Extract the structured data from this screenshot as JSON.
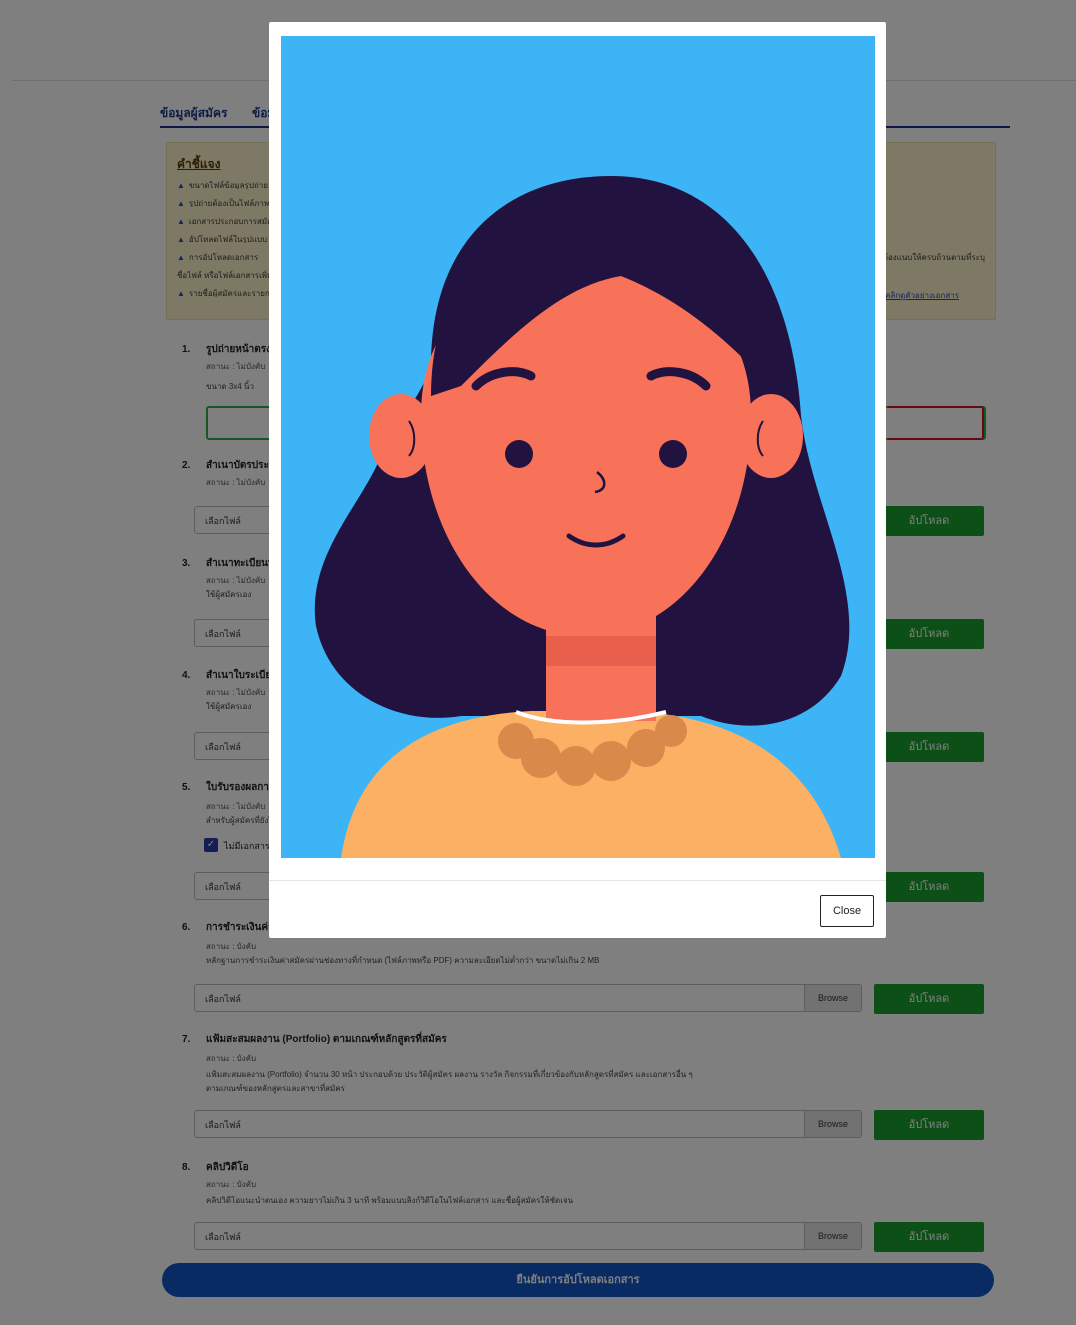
{
  "tabs": [
    {
      "label": "ข้อมูลผู้สมัคร"
    },
    {
      "label": "ข้อมูล"
    }
  ],
  "notice": {
    "title": "คำชี้แจง",
    "lines": [
      "ขนาดไฟล์ข้อมูลรูปถ่าย",
      "รูปถ่ายต้องเป็นไฟล์ภาพ",
      "เอกสารประกอบการสมัคร",
      "อัปโหลดไฟล์ในรูปแบบ",
      "การอัปโหลดเอกสาร",
      "ชื่อไฟล์ หรือไฟล์เอกสารเพิ่มเติม",
      "รายชื่อผู้สมัครและรายการ"
    ],
    "right_line": "และเอกสารที่จำเป็นต้องแนบให้ครบถ้วนตามที่ระบุ",
    "link": "คลิกดูตัวอย่างเอกสาร"
  },
  "items": [
    {
      "num": "1.",
      "title": "รูปถ่ายหน้าตรง",
      "sub": "สถานะ : ไม่บังคับ",
      "note": "ขนาด 3x4 นิ้ว"
    },
    {
      "num": "2.",
      "title": "สำเนาบัตรประชาชน",
      "sub": "สถานะ : ไม่บังคับ"
    },
    {
      "num": "3.",
      "title": "สำเนาทะเบียนบ้าน",
      "sub": "สถานะ : ไม่บังคับ",
      "note": "ใช้ผู้สมัครเอง"
    },
    {
      "num": "4.",
      "title": "สำเนาใบระเบียน",
      "sub": "สถานะ : ไม่บังคับ",
      "note": "ใช้ผู้สมัครเอง"
    },
    {
      "num": "5.",
      "title": "ใบรับรองผลการเรียน",
      "sub": "สถานะ : ไม่บังคับ",
      "note": "สำหรับผู้สมัครที่ยังไม่จบการศึกษา"
    },
    {
      "num": "6.",
      "title": "การชำระเงินค่าสมัคร",
      "sub": "สถานะ : บังคับ",
      "note": "หลักฐานการชำระเงินค่าสมัครผ่านช่องทางที่กำหนด (ไฟล์ภาพหรือ PDF) ความละเอียดไม่ต่ำกว่า ขนาดไม่เกิน 2 MB"
    },
    {
      "num": "7.",
      "title": "แฟ้มสะสมผลงาน (Portfolio) ตามเกณฑ์หลักสูตรที่สมัคร",
      "sub": "สถานะ : บังคับ",
      "note": "แฟ้มสะสมผลงาน (Portfolio) จำนวน 30 หน้า ประกอบด้วย ประวัติผู้สมัคร ผลงาน รางวัล กิจกรรมที่เกี่ยวข้องกับหลักสูตรที่สมัคร และเอกสารอื่น ๆ",
      "note2": "ตามเกณฑ์ของหลักสูตรและสาขาที่สมัคร"
    },
    {
      "num": "8.",
      "title": "คลิปวิดีโอ",
      "sub": "สถานะ : บังคับ",
      "note": "คลิปวิดีโอแนะนำตนเอง ความยาวไม่เกิน 3 นาที พร้อมแนบลิงก์วิดีโอในไฟล์เอกสาร และชื่อผู้สมัครให้ชัดเจน"
    }
  ],
  "file_input": {
    "placeholder": "เลือกไฟล์",
    "browse": "Browse"
  },
  "upload_label": "อัปโหลด",
  "checkbox_label": "ไม่มีเอกสาร",
  "submit_label": "ยืนยันการอัปโหลดเอกสาร",
  "modal": {
    "close_label": "Close",
    "image": "portrait-illustration"
  },
  "colors": {
    "tab_underline": "#1e2a8a",
    "upload_green": "#18a02e",
    "submit_blue": "#1357c9",
    "notice_bg": "#fbf2c8",
    "photo_bg": "#3db4f5",
    "hair": "#22123f",
    "skin": "#f8725a",
    "shirt": "#fbb064"
  }
}
